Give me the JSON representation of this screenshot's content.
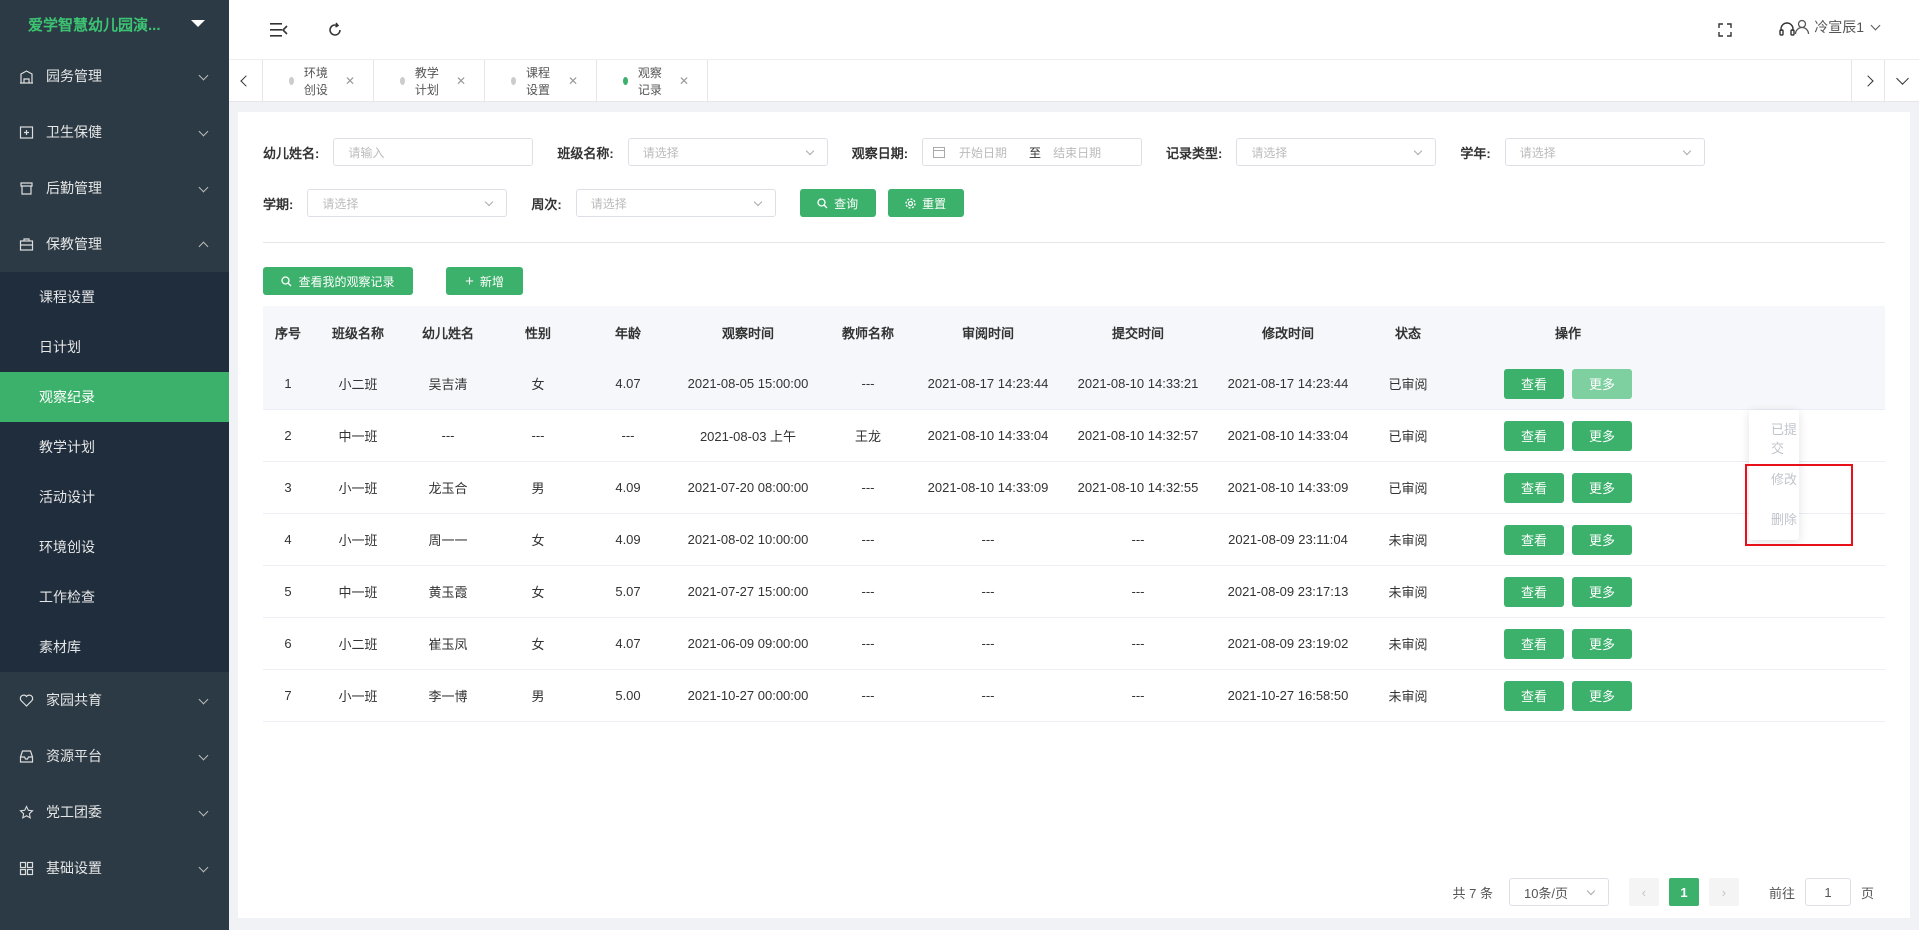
{
  "sidebar": {
    "title": "爱学智慧幼儿园演...",
    "menus": [
      {
        "label": "园务管理",
        "icon": "building-icon"
      },
      {
        "label": "卫生保健",
        "icon": "medical-box-icon"
      },
      {
        "label": "后勤管理",
        "icon": "shop-icon"
      },
      {
        "label": "保教管理",
        "icon": "briefcase-icon"
      }
    ],
    "submenu": [
      "课程设置",
      "日计划",
      "观察纪录",
      "教学计划",
      "活动设计",
      "环境创设",
      "工作检查",
      "素材库"
    ],
    "menus_after": [
      {
        "label": "家园共育",
        "icon": "heart-icon"
      },
      {
        "label": "资源平台",
        "icon": "inbox-icon"
      },
      {
        "label": "党工团委",
        "icon": "star-icon"
      },
      {
        "label": "基础设置",
        "icon": "grid-icon"
      }
    ]
  },
  "header": {
    "user": "冷宣辰1"
  },
  "tabs": [
    "环境创设",
    "教学计划",
    "课程设置",
    "观察记录"
  ],
  "filters": {
    "child_name_label": "幼儿姓名:",
    "child_name_placeholder": "请输入",
    "class_label": "班级名称:",
    "class_placeholder": "请选择",
    "date_label": "观察日期:",
    "date_start": "开始日期",
    "date_sep": "至",
    "date_end": "结束日期",
    "type_label": "记录类型:",
    "type_placeholder": "请选择",
    "year_label": "学年:",
    "year_placeholder": "请选择",
    "term_label": "学期:",
    "term_placeholder": "请选择",
    "week_label": "周次:",
    "week_placeholder": "请选择",
    "query": "查询",
    "reset": "重置"
  },
  "actions": {
    "mine": "查看我的观察记录",
    "add": "新增"
  },
  "table": {
    "headers": [
      "序号",
      "班级名称",
      "幼儿姓名",
      "性别",
      "年龄",
      "观察时间",
      "教师名称",
      "审阅时间",
      "提交时间",
      "修改时间",
      "状态",
      "操作"
    ],
    "view": "查看",
    "more": "更多",
    "rows": [
      [
        "1",
        "小二班",
        "吴吉清",
        "女",
        "4.07",
        "2021-08-05 15:00:00",
        "---",
        "2021-08-17 14:23:44",
        "2021-08-10 14:33:21",
        "2021-08-17 14:23:44",
        "已审阅"
      ],
      [
        "2",
        "中一班",
        "---",
        "---",
        "---",
        "2021-08-03 上午",
        "王龙",
        "2021-08-10 14:33:04",
        "2021-08-10 14:32:57",
        "2021-08-10 14:33:04",
        "已审阅"
      ],
      [
        "3",
        "小一班",
        "龙玉合",
        "男",
        "4.09",
        "2021-07-20 08:00:00",
        "---",
        "2021-08-10 14:33:09",
        "2021-08-10 14:32:55",
        "2021-08-10 14:33:09",
        "已审阅"
      ],
      [
        "4",
        "小一班",
        "周一一",
        "女",
        "4.09",
        "2021-08-02 10:00:00",
        "---",
        "---",
        "---",
        "2021-08-09 23:11:04",
        "未审阅"
      ],
      [
        "5",
        "中一班",
        "黄玉霞",
        "女",
        "5.07",
        "2021-07-27 15:00:00",
        "---",
        "---",
        "---",
        "2021-08-09 23:17:13",
        "未审阅"
      ],
      [
        "6",
        "小二班",
        "崔玉凤",
        "女",
        "4.07",
        "2021-06-09 09:00:00",
        "---",
        "---",
        "---",
        "2021-08-09 23:19:02",
        "未审阅"
      ],
      [
        "7",
        "小一班",
        "李一博",
        "男",
        "5.00",
        "2021-10-27 00:00:00",
        "---",
        "---",
        "---",
        "2021-10-27 16:58:50",
        "未审阅"
      ]
    ]
  },
  "dropdown": [
    "已提交",
    "修改",
    "删除"
  ],
  "pagination": {
    "total": "共 7 条",
    "page_size": "10条/页",
    "current": "1",
    "goto_prefix": "前往",
    "goto_value": "1",
    "goto_suffix": "页"
  }
}
